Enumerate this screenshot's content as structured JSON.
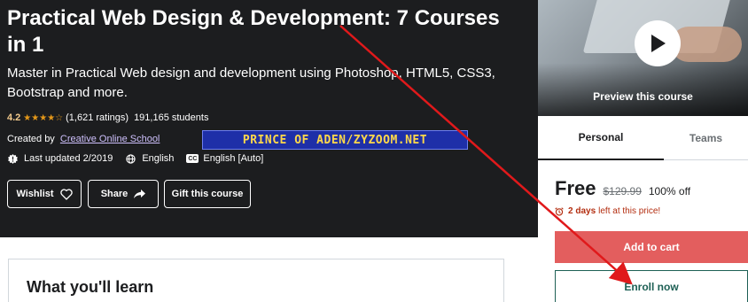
{
  "course": {
    "title": "Practical Web Design & Development: 7 Courses in 1",
    "subtitle": "Master in Practical Web design and development using Photoshop, HTML5, CSS3, Bootstrap and more.",
    "rating": "4.2",
    "stars": "★★★★☆",
    "rating_count": "(1,621 ratings)",
    "students": "191,165 students",
    "created_by_label": "Created by",
    "creator": "Creative Online School",
    "last_updated": "Last updated 2/2019",
    "language": "English",
    "captions": "English [Auto]",
    "captions_badge": "CC"
  },
  "watermark": "PRINCE OF ADEN/ZYZOOM.NET",
  "actions": {
    "wishlist": "Wishlist",
    "share": "Share",
    "gift": "Gift this course"
  },
  "learn": {
    "title": "What you'll learn"
  },
  "sidebar": {
    "preview_label": "Preview this course",
    "tabs": [
      "Personal",
      "Teams"
    ],
    "active_tab": "Personal",
    "price": "Free",
    "original_price": "$129.99",
    "discount": "100% off",
    "timer_strong": "2 days",
    "timer_text": "left at this price!",
    "add_to_cart": "Add to cart",
    "enroll": "Enroll now"
  },
  "icons": {
    "rating": "star-icon",
    "updated": "alert-badge-icon",
    "language": "globe-icon",
    "captions": "closed-captions-icon",
    "wishlist": "heart-icon",
    "share": "share-arrow-icon",
    "play": "play-icon",
    "timer": "alarm-clock-icon"
  },
  "colors": {
    "hero_bg": "#1c1d1f",
    "star": "#e59819",
    "rating_text": "#f3ca8c",
    "creator_link": "#cec0fc",
    "cart_button": "#e35e5e",
    "enroll_text": "#1e6055",
    "timer_text": "#b32d0f",
    "annotation_arrow": "#e0191b"
  }
}
